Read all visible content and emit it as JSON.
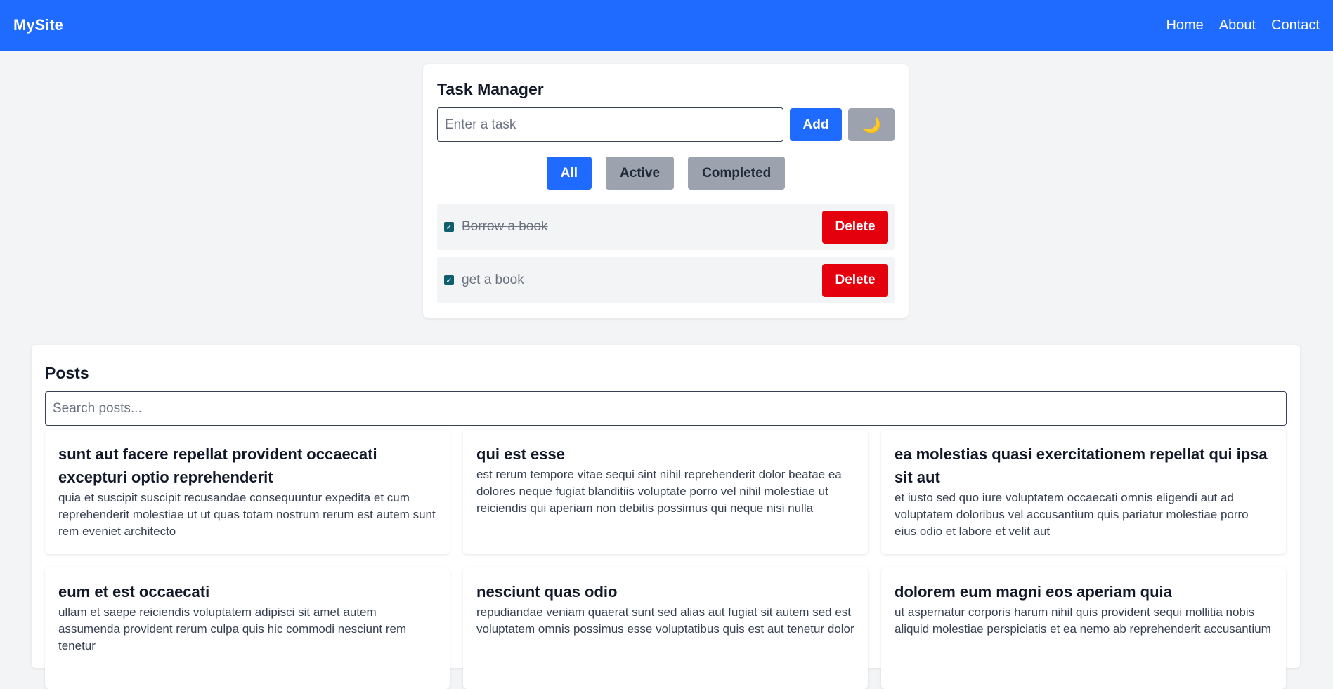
{
  "navbar": {
    "brand": "MySite",
    "links": [
      "Home",
      "About",
      "Contact"
    ]
  },
  "task_manager": {
    "title": "Task Manager",
    "input_placeholder": "Enter a task",
    "add_label": "Add",
    "theme_toggle_icon": "🌙",
    "filters": [
      "All",
      "Active",
      "Completed"
    ],
    "active_filter": "All",
    "tasks": [
      {
        "text": "Borrow a book",
        "completed": true,
        "delete_label": "Delete"
      },
      {
        "text": "get a book",
        "completed": true,
        "delete_label": "Delete"
      }
    ]
  },
  "posts": {
    "title": "Posts",
    "search_placeholder": "Search posts...",
    "items": [
      {
        "title": "sunt aut facere repellat provident occaecati excepturi optio reprehenderit",
        "body": "quia et suscipit suscipit recusandae consequuntur expedita et cum reprehenderit molestiae ut ut quas totam nostrum rerum est autem sunt rem eveniet architecto"
      },
      {
        "title": "qui est esse",
        "body": "est rerum tempore vitae sequi sint nihil reprehenderit dolor beatae ea dolores neque fugiat blanditiis voluptate porro vel nihil molestiae ut reiciendis qui aperiam non debitis possimus qui neque nisi nulla"
      },
      {
        "title": "ea molestias quasi exercitationem repellat qui ipsa sit aut",
        "body": "et iusto sed quo iure voluptatem occaecati omnis eligendi aut ad voluptatem doloribus vel accusantium quis pariatur molestiae porro eius odio et labore et velit aut"
      },
      {
        "title": "eum et est occaecati",
        "body": "ullam et saepe reiciendis voluptatem adipisci sit amet autem assumenda provident rerum culpa quis hic commodi nesciunt rem tenetur"
      },
      {
        "title": "nesciunt quas odio",
        "body": "repudiandae veniam quaerat sunt sed alias aut fugiat sit autem sed est voluptatem omnis possimus esse voluptatibus quis est aut tenetur dolor"
      },
      {
        "title": "dolorem eum magni eos aperiam quia",
        "body": "ut aspernatur corporis harum nihil quis provident sequi mollitia nobis aliquid molestiae perspiciatis et ea nemo ab reprehenderit accusantium"
      }
    ]
  }
}
